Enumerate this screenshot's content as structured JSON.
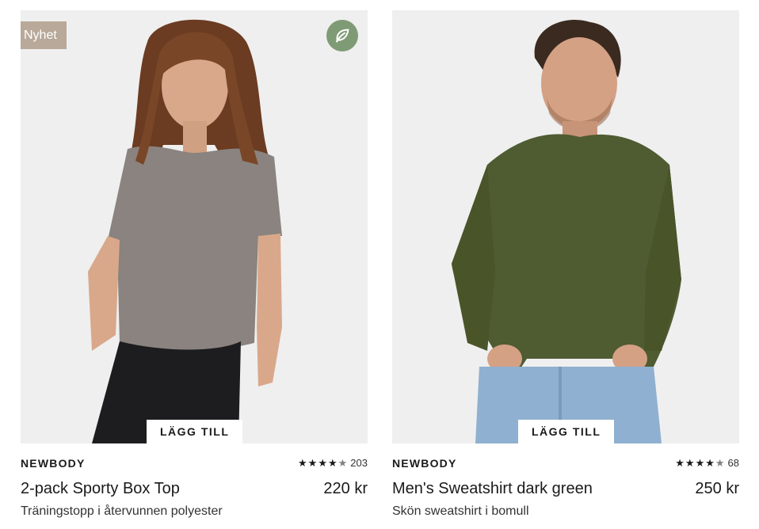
{
  "products": [
    {
      "badge": "Nyhet",
      "eco_icon": "leaf-icon",
      "add_label": "LÄGG TILL",
      "brand": "NEWBODY",
      "rating": 4.5,
      "review_count": "203",
      "name": "2-pack Sporty Box Top",
      "price": "220 kr",
      "description": "Träningstopp i återvunnen polyester",
      "colors": {
        "garment": "#8a837f",
        "pants": "#1d1d1f",
        "hair": "#6b3c22",
        "skin": "#d9a88a"
      }
    },
    {
      "add_label": "LÄGG TILL",
      "brand": "NEWBODY",
      "rating": 4.5,
      "review_count": "68",
      "name": "Men's Sweatshirt dark green",
      "price": "250 kr",
      "description": "Skön sweatshirt i bomull",
      "colors": {
        "garment": "#4f5b31",
        "pants": "#8fb0d0",
        "hair": "#3b2a20",
        "skin": "#d4a184"
      }
    }
  ],
  "colors": {
    "badge_bg": "#b8a99a",
    "eco_bg": "#7f9b76",
    "image_bg": "#efefef"
  }
}
